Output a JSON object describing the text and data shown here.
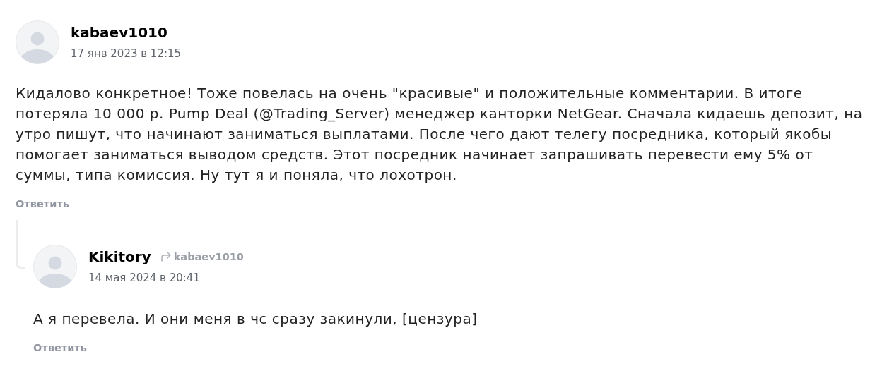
{
  "comments": [
    {
      "author": "kabaev1010",
      "date": "17 янв 2023 в 12:15",
      "text": "Кидалово конкретное! Тоже повелась на очень \"красивые\" и положительные комментарии. В итоге потеряла 10 000 р. Pump Deal (@Trading_Server) менеджер канторки NetGear. Сначала кидаешь депозит, на утро пишут, что начинают заниматься выплатами. После чего дают телегу посредника, который якобы помогает заниматься выводом средств. Этот посредник начинает запрашивать перевести ему 5% от суммы, типа комиссия. Ну тут я и поняла, что лохотрон.",
      "reply_label": "Ответить",
      "replies": [
        {
          "author": "Kikitory",
          "reply_to": "kabaev1010",
          "date": "14 мая 2024 в 20:41",
          "text": "А я перевела. И они меня в чс сразу закинули, [цензура]",
          "reply_label": "Ответить"
        }
      ]
    }
  ]
}
